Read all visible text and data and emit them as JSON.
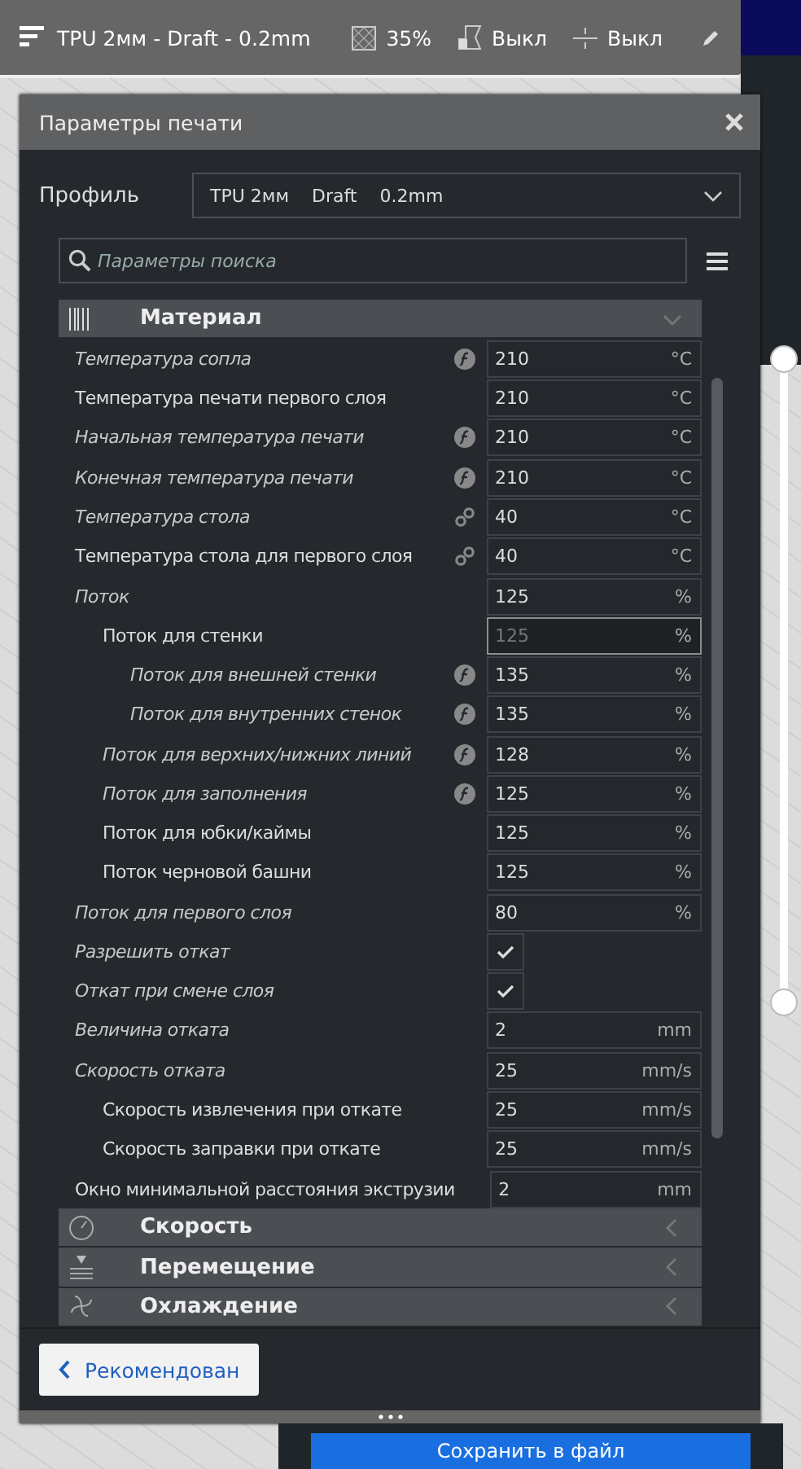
{
  "top_bar": {
    "profile": "TPU 2мм - Draft - 0.2mm",
    "infill": "35%",
    "support": "Выкл",
    "adhesion": "Выкл"
  },
  "panel": {
    "title": "Параметры печати",
    "profile_label": "Профиль",
    "profile_value": [
      "TPU 2мм",
      "Draft",
      "0.2mm"
    ],
    "search": {
      "placeholder": "Параметры поиска"
    },
    "categories": [
      {
        "kind": "material",
        "label": "Материал",
        "expanded": true,
        "settings": [
          {
            "label": "Температура сопла",
            "modified": true,
            "formula": true,
            "kind": "number",
            "value": "210",
            "unit": "°C"
          },
          {
            "label": "Температура печати первого слоя",
            "modified": false,
            "kind": "number",
            "value": "210",
            "unit": "°C"
          },
          {
            "label": "Начальная температура печати",
            "modified": true,
            "formula": true,
            "kind": "number",
            "value": "210",
            "unit": "°C"
          },
          {
            "label": "Конечная температура печати",
            "modified": true,
            "formula": true,
            "kind": "number",
            "value": "210",
            "unit": "°C"
          },
          {
            "label": "Температура стола",
            "modified": true,
            "linked": true,
            "kind": "number",
            "value": "40",
            "unit": "°C"
          },
          {
            "label": "Температура стола для первого слоя",
            "modified": false,
            "linked": true,
            "kind": "number",
            "value": "40",
            "unit": "°C"
          },
          {
            "label": "Поток",
            "modified": true,
            "kind": "number",
            "value": "125",
            "unit": "%",
            "children": [
              {
                "label": "Поток для стенки",
                "modified": false,
                "kind": "number",
                "value": "125",
                "unit": "%",
                "highlighted": true,
                "children": [
                  {
                    "label": "Поток для внешней стенки",
                    "modified": true,
                    "formula": true,
                    "kind": "number",
                    "value": "135",
                    "unit": "%"
                  },
                  {
                    "label": "Поток для внутренних стенок",
                    "modified": true,
                    "formula": true,
                    "kind": "number",
                    "value": "135",
                    "unit": "%"
                  }
                ]
              },
              {
                "label": "Поток для верхних/нижних линий",
                "modified": true,
                "formula": true,
                "kind": "number",
                "value": "128",
                "unit": "%"
              },
              {
                "label": "Поток для заполнения",
                "modified": true,
                "formula": true,
                "kind": "number",
                "value": "125",
                "unit": "%"
              },
              {
                "label": "Поток для юбки/каймы",
                "modified": false,
                "kind": "number",
                "value": "125",
                "unit": "%"
              },
              {
                "label": "Поток черновой башни",
                "modified": false,
                "kind": "number",
                "value": "125",
                "unit": "%"
              }
            ]
          },
          {
            "label": "Поток для первого слоя",
            "modified": true,
            "kind": "number",
            "value": "80",
            "unit": "%"
          },
          {
            "label": "Разрешить откат",
            "modified": true,
            "kind": "checkbox",
            "checked": true
          },
          {
            "label": "Откат при смене слоя",
            "modified": true,
            "kind": "checkbox",
            "checked": true
          },
          {
            "label": "Величина отката",
            "modified": true,
            "kind": "number",
            "value": "2",
            "unit": "mm"
          },
          {
            "label": "Скорость отката",
            "modified": true,
            "kind": "number",
            "value": "25",
            "unit": "mm/s",
            "children": [
              {
                "label": "Скорость извлечения при откате",
                "modified": false,
                "kind": "number",
                "value": "25",
                "unit": "mm/s"
              },
              {
                "label": "Скорость заправки при откате",
                "modified": false,
                "kind": "number",
                "value": "25",
                "unit": "mm/s"
              }
            ]
          },
          {
            "label": "Окно минимальной расстояния экструзии",
            "modified": false,
            "kind": "number",
            "value": "2",
            "unit": "mm"
          }
        ]
      },
      {
        "kind": "speed",
        "label": "Скорость",
        "expanded": false
      },
      {
        "kind": "travel",
        "label": "Перемещение",
        "expanded": false
      },
      {
        "kind": "cooling",
        "label": "Охлаждение",
        "expanded": false
      }
    ],
    "back_button": "Рекомендован"
  },
  "layer_slider": {
    "handles": [
      {
        "level": 1
      },
      {
        "level": 0
      }
    ]
  },
  "save_button": "Сохранить в файл"
}
